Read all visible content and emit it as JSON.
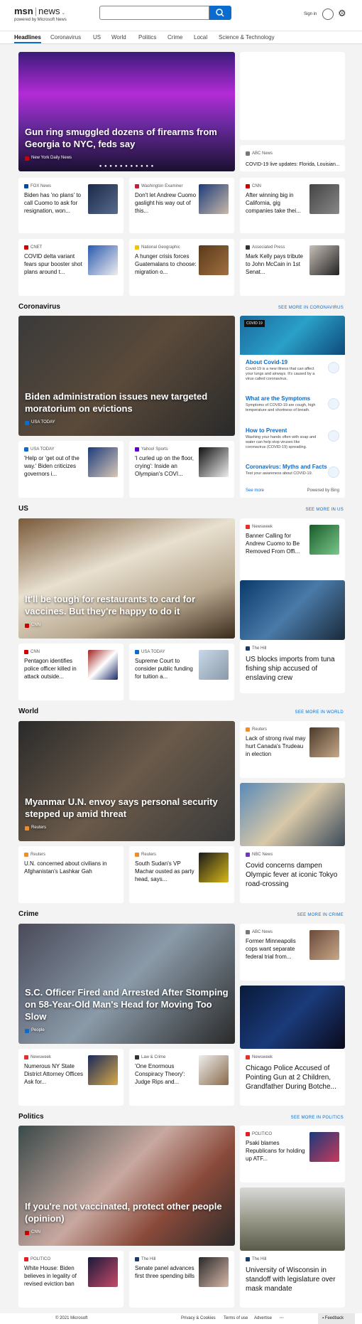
{
  "header": {
    "brand": "msn",
    "section": "news",
    "powered": "powered by Microsoft News",
    "search_placeholder": "",
    "signin": "Sign in"
  },
  "nav": [
    "Headlines",
    "Coronavirus",
    "US",
    "World",
    "Politics",
    "Crime",
    "Local",
    "Science & Technology"
  ],
  "headlines": {
    "hero": {
      "title": "Gun ring smuggled dozens of firearms from Georgia to NYC, feds say",
      "source": "New York Daily News"
    },
    "side_top": {
      "source": "ABC News",
      "title": "COVID-19 live updates: Florida, Louisian..."
    },
    "row1": [
      {
        "source": "FOX News",
        "title": "Biden has 'no plans' to call Cuomo to ask for resignation, won..."
      },
      {
        "source": "Washington Examiner",
        "title": "Don't let Andrew Cuomo gaslight his way out of this..."
      },
      {
        "source": "CNN",
        "title": "After winning big in California, gig companies take thei..."
      }
    ],
    "row2": [
      {
        "source": "CNET",
        "title": "COVID delta variant fears spur booster shot plans around t..."
      },
      {
        "source": "National Geographic",
        "title": "A hunger crisis forces Guatemalans to choose: migration o..."
      },
      {
        "source": "Associated Press",
        "title": "Mark Kelly pays tribute to John McCain in 1st Senat..."
      }
    ]
  },
  "coronavirus": {
    "label": "Coronavirus",
    "more": "SEE MORE IN CORONAVIRUS",
    "hero": {
      "title": "Biden administration issues new targeted moratorium on evictions",
      "source": "USA TODAY"
    },
    "row": [
      {
        "source": "USA TODAY",
        "title": "'Help or 'get out of the way.' Biden criticizes governors i..."
      },
      {
        "source": "Yahoo! Sports",
        "title": "'I curled up on the floor, crying': Inside an Olympian's COVI..."
      }
    ],
    "panel": {
      "tag": "COVID 19",
      "items": [
        {
          "h": "About Covid-19",
          "d": "Covid-19 is a new illness that can affect your lungs and airways. It's caused by a virus called coronavirus."
        },
        {
          "h": "What are the Symptoms",
          "d": "Symptoms of COVID-19 are cough, high temperature and shortness of breath."
        },
        {
          "h": "How to Prevent",
          "d": "Washing your hands often with soap and water can help stop viruses like coronavirus (COVID-19) spreading."
        },
        {
          "h": "Coronavirus: Myths and Facts",
          "d": "Test your awareness about COVID-19."
        }
      ],
      "see_more": "See more",
      "powered": "Powered by Bing"
    }
  },
  "us": {
    "label": "US",
    "more": "SEE MORE IN US",
    "hero": {
      "title": "It'll be tough for restaurants to card for vaccines. But they're happy to do it",
      "source": "CNN"
    },
    "side_top": {
      "source": "Newsweek",
      "title": "Banner Calling for Andrew Cuomo to Be Removed From Offi..."
    },
    "side_big": {
      "source": "The Hill",
      "title": "US blocks imports from tuna fishing ship accused of enslaving crew"
    },
    "row": [
      {
        "source": "CNN",
        "title": "Pentagon identifies police officer killed in attack outside..."
      },
      {
        "source": "USA TODAY",
        "title": "Supreme Court to consider public funding for tuition a..."
      }
    ]
  },
  "world": {
    "label": "World",
    "more": "SEE MORE IN WORLD",
    "hero": {
      "title": "Myanmar U.N. envoy says personal security stepped up amid threat",
      "source": "Reuters"
    },
    "side_top": {
      "source": "Reuters",
      "title": "Lack of strong rival may hurt Canada's Trudeau in election"
    },
    "side_big": {
      "source": "NBC News",
      "title": "Covid concerns dampen Olympic fever at iconic Tokyo road-crossing"
    },
    "row": [
      {
        "source": "Reuters",
        "title": "U.N. concerned about civilians in Afghanistan's Lashkar Gah"
      },
      {
        "source": "Reuters",
        "title": "South Sudan's VP Machar ousted as party head, says..."
      }
    ]
  },
  "crime": {
    "label": "Crime",
    "more": "SEE MORE IN CRIME",
    "hero": {
      "title": "S.C. Officer Fired and Arrested After Stomping on 58-Year-Old Man's Head for Moving Too Slow",
      "source": "People"
    },
    "side_top": {
      "source": "ABC News",
      "title": "Former Minneapolis cops want separate federal trial from..."
    },
    "side_big": {
      "source": "Newsweek",
      "title": "Chicago Police Accused of Pointing Gun at 2 Children, Grandfather During Botche..."
    },
    "row": [
      {
        "source": "Newsweek",
        "title": "Numerous NY State District Attorney Offices Ask for..."
      },
      {
        "source": "Law & Crime",
        "title": "'One Enormous Conspiracy Theory': Judge Rips and..."
      }
    ]
  },
  "politics": {
    "label": "Politics",
    "more": "SEE MORE IN POLITICS",
    "hero": {
      "title": "If you're not vaccinated, protect other people (opinion)",
      "source": "CNN"
    },
    "side_top": {
      "source": "POLITICO",
      "title": "Psaki blames Republicans for holding up ATF..."
    },
    "side_big": {
      "source": "The Hill",
      "title": "University of Wisconsin in standoff with legislature over mask mandate"
    },
    "row": [
      {
        "source": "POLITICO",
        "title": "White House: Biden believes in legality of revised eviction ban"
      },
      {
        "source": "The Hill",
        "title": "Senate panel advances first three spending bills"
      }
    ]
  },
  "footer": {
    "copyright": "© 2021 Microsoft",
    "privacy": "Privacy & Cookies",
    "terms": "Terms of use",
    "advertise": "Advertise",
    "feedback": "Feedback"
  }
}
